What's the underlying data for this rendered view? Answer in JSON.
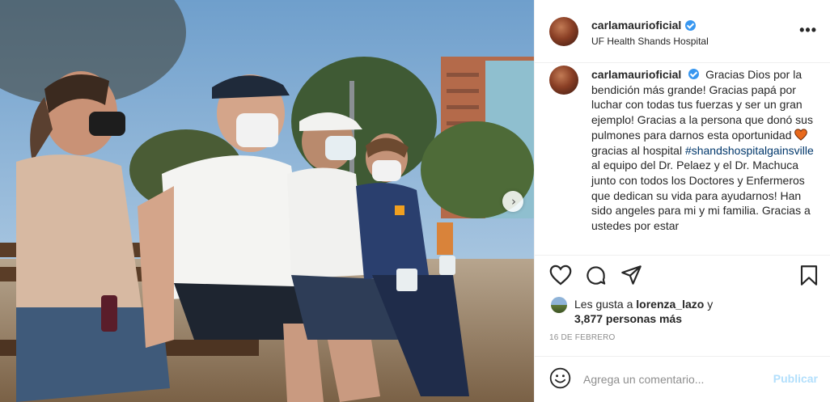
{
  "post": {
    "username": "carlamaurioficial",
    "location": "UF Health Shands Hospital",
    "more_icon": "more-horizontal-icon",
    "verified_icon": "verified-badge-icon"
  },
  "caption": {
    "username": "carlamaurioficial",
    "text_part1": "Gracias Dios por la bendición más grande! Gracias papá por luchar con todas tus fuerzas y ser un gran ejemplo! Gracias a la persona que donó sus pulmones para darnos esta oportunidad",
    "emoji": "orange-heart",
    "text_part2": "gracias al hospital",
    "hashtag": "#shandshospitalgainsville",
    "text_part3": "al equipo del Dr. Pelaez y el Dr. Machuca junto con todos los Doctores y Enfermeros que dedican su vida para ayudarnos! Han sido angeles para mi y mi familia. Gracias a ustedes por estar"
  },
  "actions": {
    "like_icon": "heart-icon",
    "comment_icon": "comment-icon",
    "share_icon": "share-icon",
    "save_icon": "bookmark-icon"
  },
  "likes": {
    "prefix": "Les gusta a",
    "liker": "lorenza_lazo",
    "conjunction": "y",
    "others": "3,877 personas más"
  },
  "date": "16 DE FEBRERO",
  "comment": {
    "placeholder": "Agrega un comentario...",
    "publish_label": "Publicar",
    "emoji_icon": "smiley-icon"
  },
  "carousel": {
    "next_icon": "chevron-right-icon",
    "next_glyph": "›"
  },
  "colors": {
    "link": "#00376b",
    "verified": "#3897f0",
    "publish_disabled": "#b2dffc",
    "secondary_text": "#8e8e8e",
    "heart_emoji": "#e8691c"
  }
}
